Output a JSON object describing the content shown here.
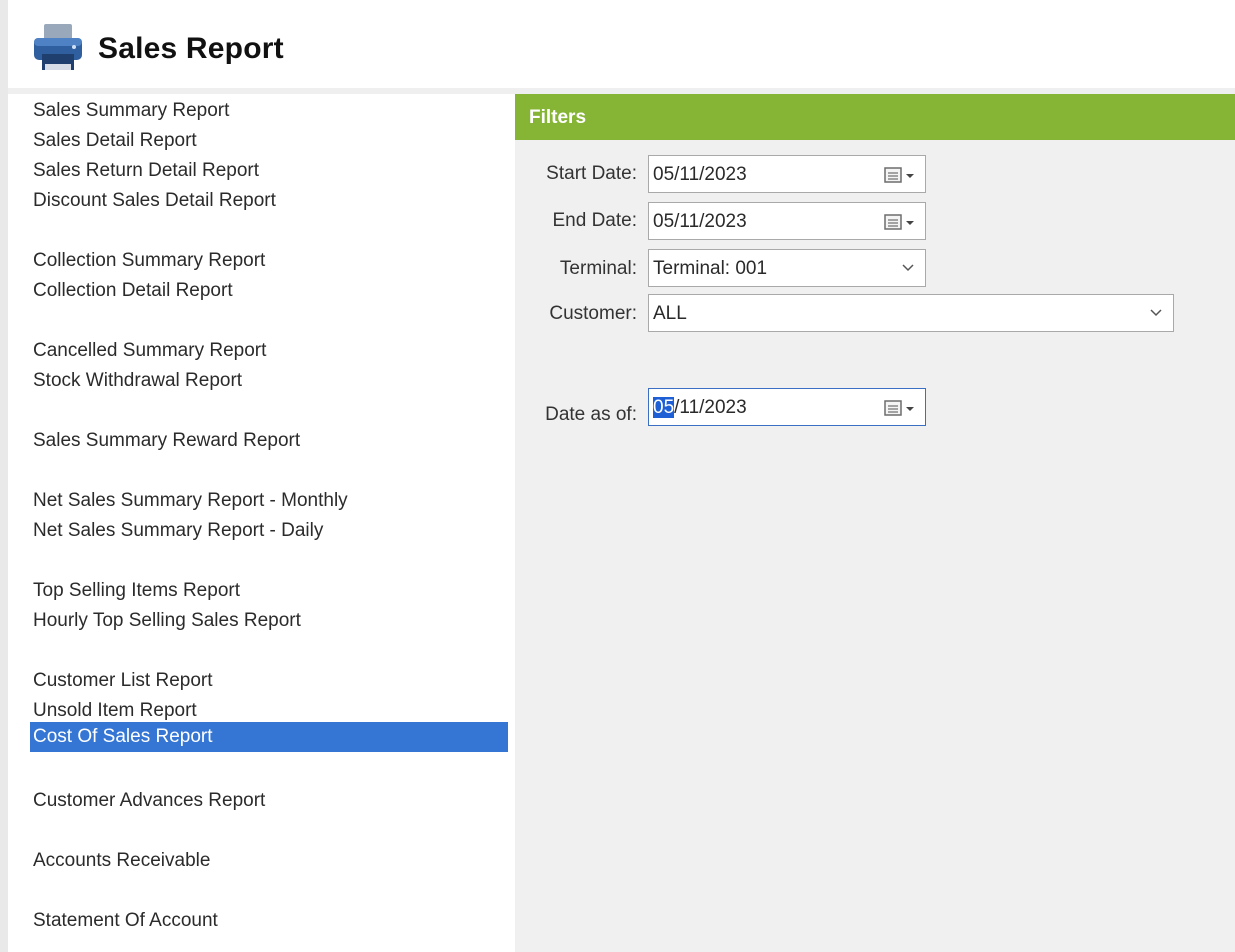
{
  "header": {
    "title": "Sales Report",
    "icon": "printer-icon"
  },
  "reports": [
    {
      "label": "Sales Summary Report",
      "selected": false
    },
    {
      "label": "Sales Detail Report",
      "selected": false
    },
    {
      "label": "Sales Return Detail Report",
      "selected": false
    },
    {
      "label": "Discount Sales Detail Report",
      "selected": false
    },
    {
      "label": "Collection Summary Report",
      "selected": false
    },
    {
      "label": "Collection Detail Report",
      "selected": false
    },
    {
      "label": "Cancelled Summary Report",
      "selected": false
    },
    {
      "label": "Stock Withdrawal Report",
      "selected": false
    },
    {
      "label": "Sales Summary Reward Report",
      "selected": false
    },
    {
      "label": "Net Sales Summary Report - Monthly",
      "selected": false
    },
    {
      "label": "Net Sales Summary Report - Daily",
      "selected": false
    },
    {
      "label": "Top Selling Items Report",
      "selected": false
    },
    {
      "label": "Hourly Top Selling Sales Report",
      "selected": false
    },
    {
      "label": "Customer List Report",
      "selected": false
    },
    {
      "label": "Unsold Item Report",
      "selected": false
    },
    {
      "label": "Cost Of Sales Report",
      "selected": true
    },
    {
      "label": "Customer Advances Report",
      "selected": false
    },
    {
      "label": "Accounts Receivable",
      "selected": false
    },
    {
      "label": "Statement Of Account",
      "selected": false
    }
  ],
  "filters": {
    "title": "Filters",
    "start_date": {
      "label": "Start Date:",
      "value": "05/11/2023"
    },
    "end_date": {
      "label": "End Date:",
      "value": "05/11/2023"
    },
    "terminal": {
      "label": "Terminal:",
      "value": "Terminal: 001"
    },
    "customer": {
      "label": "Customer:",
      "value": "ALL"
    },
    "date_as_of": {
      "label": "Date as of:",
      "value_selected": "05",
      "value_rest": "/11/2023"
    }
  },
  "colors": {
    "filters_bar": "#86b435",
    "selected_item": "#3576d4",
    "panel_bg": "#f0f0f0"
  }
}
